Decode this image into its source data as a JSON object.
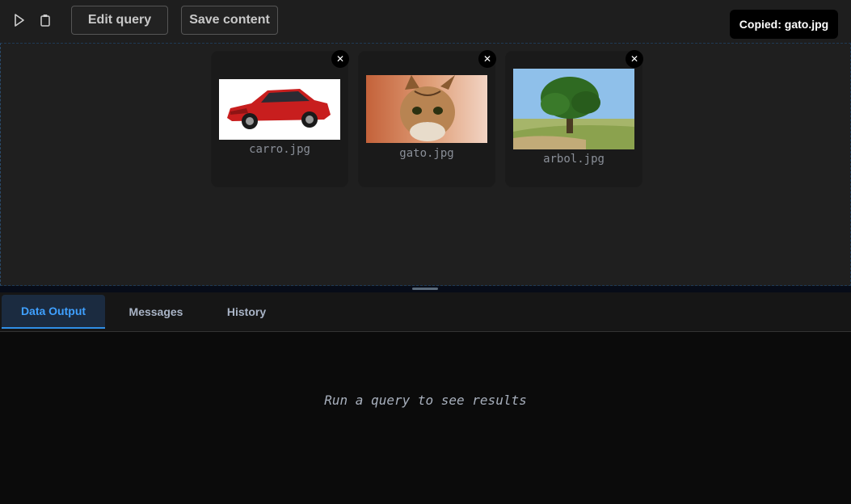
{
  "toolbar": {
    "run_icon": "play-icon",
    "clipboard_icon": "clipboard-icon",
    "edit_query_label": "Edit query",
    "save_content_label": "Save content"
  },
  "toast": {
    "text": "Copied: gato.jpg"
  },
  "images": [
    {
      "filename": "carro.jpg",
      "subject": "red car"
    },
    {
      "filename": "gato.jpg",
      "subject": "tabby cat"
    },
    {
      "filename": "arbol.jpg",
      "subject": "green tree"
    }
  ],
  "close_icon": "close-icon",
  "tabs": [
    {
      "label": "Data Output",
      "active": true
    },
    {
      "label": "Messages",
      "active": false
    },
    {
      "label": "History",
      "active": false
    }
  ],
  "output": {
    "empty_message": "Run a query to see results"
  },
  "colors": {
    "accent": "#3fa0ff",
    "active_tab_bg": "#1b2b40"
  }
}
